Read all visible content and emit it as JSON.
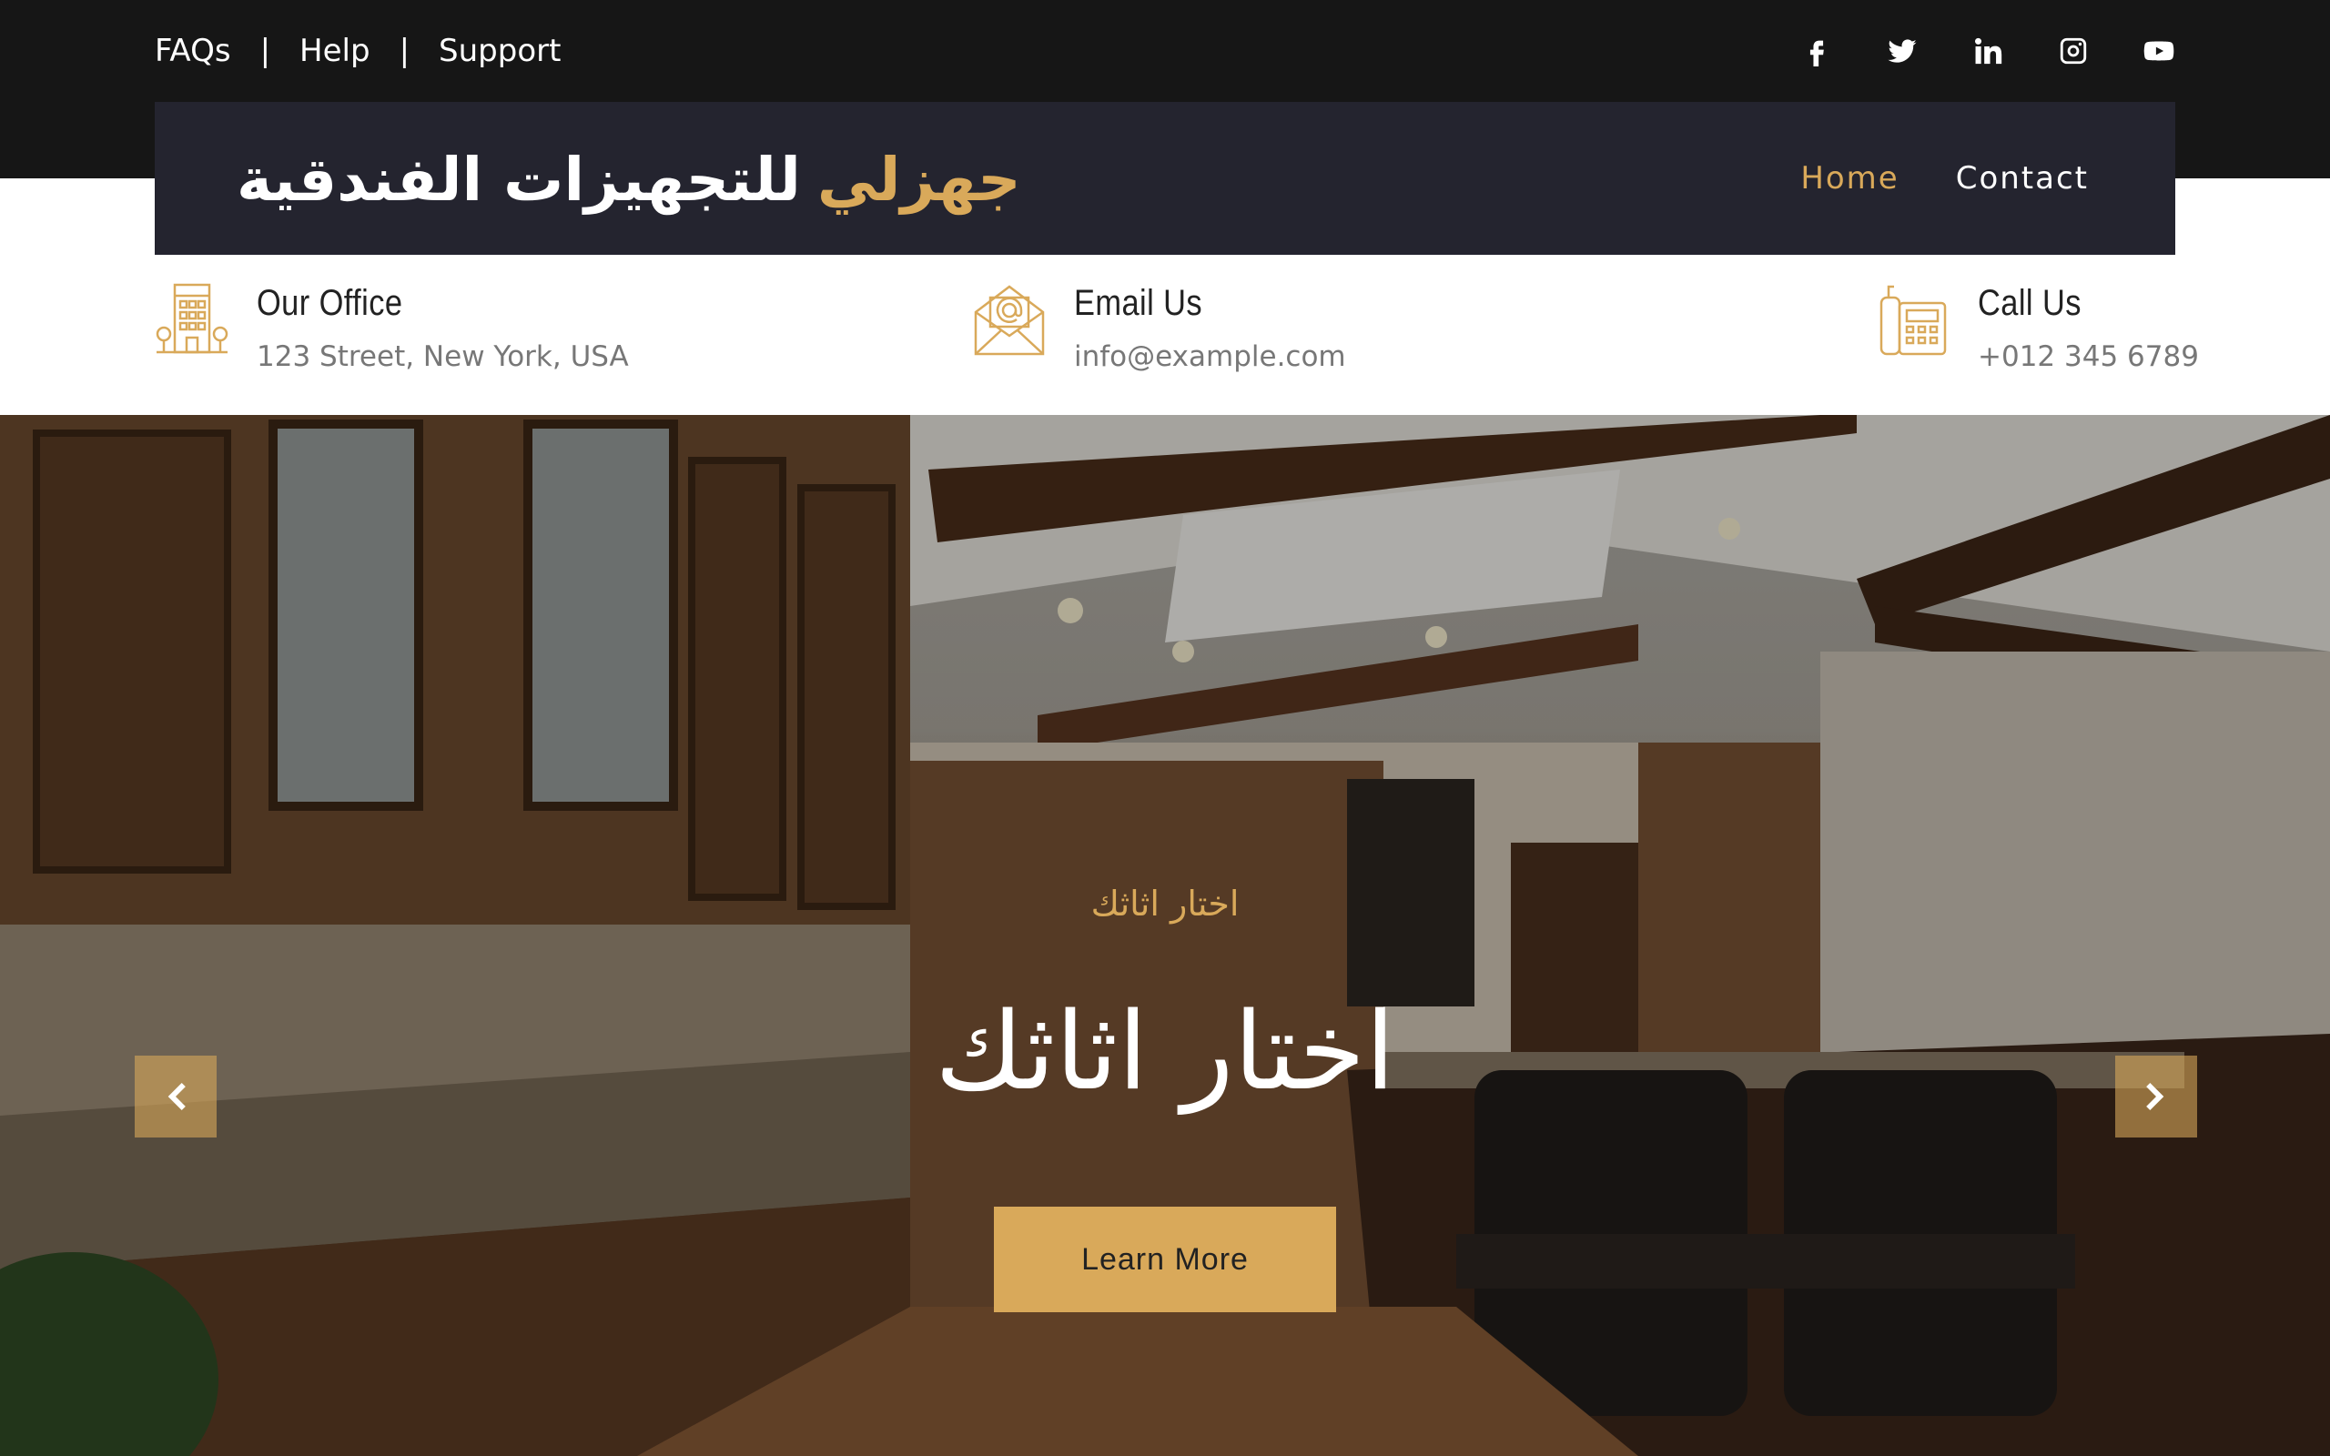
{
  "topbar": {
    "links": [
      "FAQs",
      "Help",
      "Support"
    ],
    "separator": "|",
    "socials": [
      "facebook-icon",
      "twitter-icon",
      "linkedin-icon",
      "instagram-icon",
      "youtube-icon"
    ]
  },
  "navbar": {
    "brand_accent": "جهزلي",
    "brand_rest": "للتجهيزات الفندقية",
    "links": [
      "Home",
      "Contact"
    ],
    "active": "Home"
  },
  "contact": {
    "office": {
      "title": "Our Office",
      "value": "123 Street, New York, USA",
      "icon": "building-icon"
    },
    "email": {
      "title": "Email Us",
      "value": "info@example.com",
      "icon": "envelope-icon"
    },
    "call": {
      "title": "Call Us",
      "value": "+012 345 6789",
      "icon": "phone-icon"
    }
  },
  "hero": {
    "subtitle": "اختار اثاثك",
    "title": "اختار اثاثك",
    "button": "Learn More",
    "prev_icon": "chevron-left-icon",
    "next_icon": "chevron-right-icon"
  },
  "colors": {
    "accent": "#d9a95a",
    "dark": "#161616",
    "navbar": "#24242f"
  }
}
